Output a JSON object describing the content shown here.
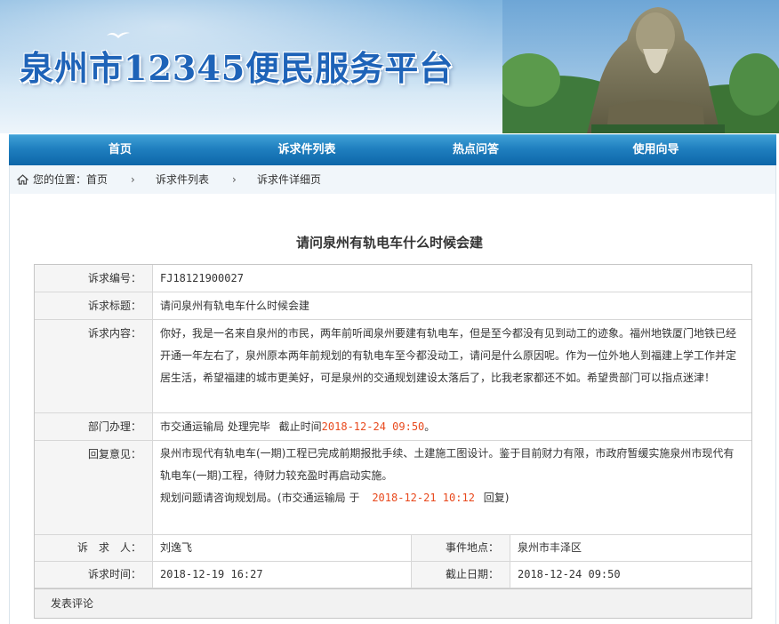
{
  "banner": {
    "title": "泉州市12345便民服务平台"
  },
  "nav": {
    "items": [
      {
        "label": "首页"
      },
      {
        "label": "诉求件列表"
      },
      {
        "label": "热点问答"
      },
      {
        "label": "使用向导"
      }
    ]
  },
  "breadcrumb": {
    "prefix": "您的位置：",
    "home": "首页",
    "sep": "›",
    "list": "诉求件列表",
    "detail": "诉求件详细页"
  },
  "page_title": "请问泉州有轨电车什么时候会建",
  "detail": {
    "code_label": "诉求编号：",
    "code": "FJ18121900027",
    "title_label": "诉求标题：",
    "title": "请问泉州有轨电车什么时候会建",
    "content_label": "诉求内容：",
    "content": "你好，我是一名来自泉州的市民，两年前听闻泉州要建有轨电车，但是至今都没有见到动工的迹象。福州地铁厦门地铁已经开通一年左右了，泉州原本两年前规划的有轨电车至今都没动工，请问是什么原因呢。作为一位外地人到福建上学工作并定居生活，希望福建的城市更美好，可是泉州的交通规划建设太落后了，比我老家都还不如。希望贵部门可以指点迷津！",
    "dept_label": "部门办理：",
    "dept_text": "市交通运输局 处理完毕",
    "deadline_prefix": "截止时间",
    "deadline": "2018-12-24 09:50",
    "deadline_suffix": "。",
    "reply_label": "回复意见：",
    "reply_line1": "泉州市现代有轨电车(一期)工程已完成前期报批手续、土建施工图设计。鉴于目前财力有限，市政府暂缓实施泉州市现代有轨电车(一期)工程，待财力较充盈时再启动实施。",
    "reply_line2_prefix": "规划问题请咨询规划局。(市交通运输局 于",
    "reply_time": "2018-12-21 10:12",
    "reply_line2_suffix": "回复)",
    "person_label": "诉　求　人：",
    "person": "刘逸飞",
    "location_label": "事件地点：",
    "location": "泉州市丰泽区",
    "time_label": "诉求时间：",
    "time": "2018-12-19 16:27",
    "due_label": "截止日期：",
    "due": "2018-12-24 09:50"
  },
  "comment": {
    "label": "发表评论"
  },
  "colors": {
    "nav": "#1f7fbf",
    "accent_red": "#e8491d",
    "title_blue": "#1e63b8"
  },
  "icons": {
    "home": "home-icon",
    "bird": "bird-icon"
  }
}
